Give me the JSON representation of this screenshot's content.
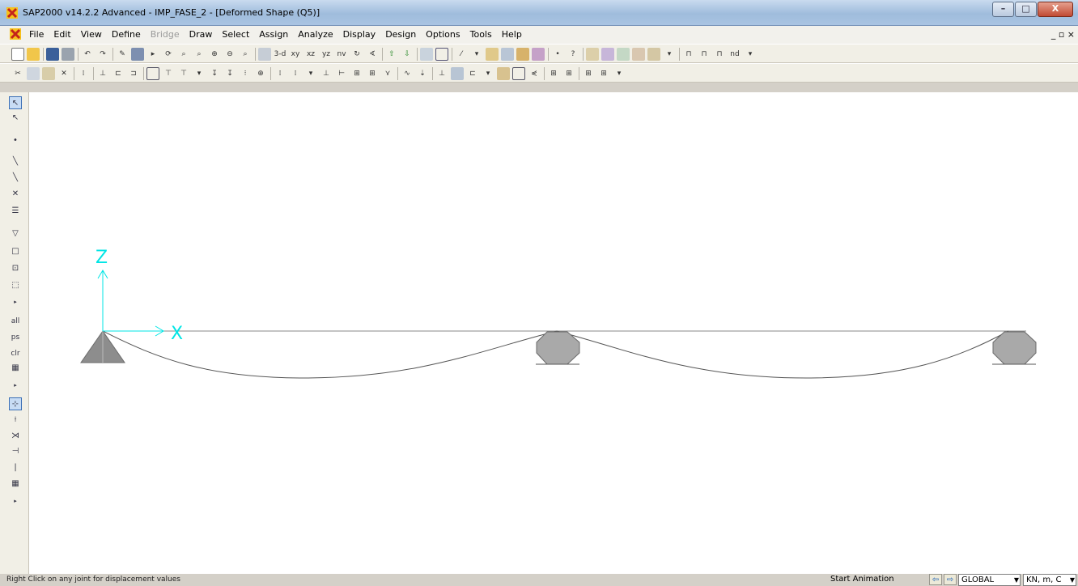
{
  "window": {
    "title": "SAP2000 v14.2.2 Advanced  - IMP_FASE_2 - [Deformed Shape (Q5)]",
    "controls": {
      "minimize": "–",
      "maximize": "□",
      "close": "X"
    }
  },
  "menubar": {
    "items": [
      {
        "label": "File",
        "enabled": true
      },
      {
        "label": "Edit",
        "enabled": true
      },
      {
        "label": "View",
        "enabled": true
      },
      {
        "label": "Define",
        "enabled": true
      },
      {
        "label": "Bridge",
        "enabled": false
      },
      {
        "label": "Draw",
        "enabled": true
      },
      {
        "label": "Select",
        "enabled": true
      },
      {
        "label": "Assign",
        "enabled": true
      },
      {
        "label": "Analyze",
        "enabled": true
      },
      {
        "label": "Display",
        "enabled": true
      },
      {
        "label": "Design",
        "enabled": true
      },
      {
        "label": "Options",
        "enabled": true
      },
      {
        "label": "Tools",
        "enabled": true
      },
      {
        "label": "Help",
        "enabled": true
      }
    ],
    "mdi_controls": "_ ▫ ×"
  },
  "toolbar_top": {
    "view_3d": "3-d",
    "view_xy": "xy",
    "view_xz": "xz",
    "view_yz": "yz",
    "view_nv": "nv",
    "nd": "nd"
  },
  "axes": {
    "z_label": "Z",
    "x_label": "X",
    "color": "#00e5e5"
  },
  "statusbar": {
    "message": "Right Click on any joint for displacement values",
    "animation": "Start Animation",
    "coord_system": "GLOBAL",
    "units": "KN, m, C"
  }
}
